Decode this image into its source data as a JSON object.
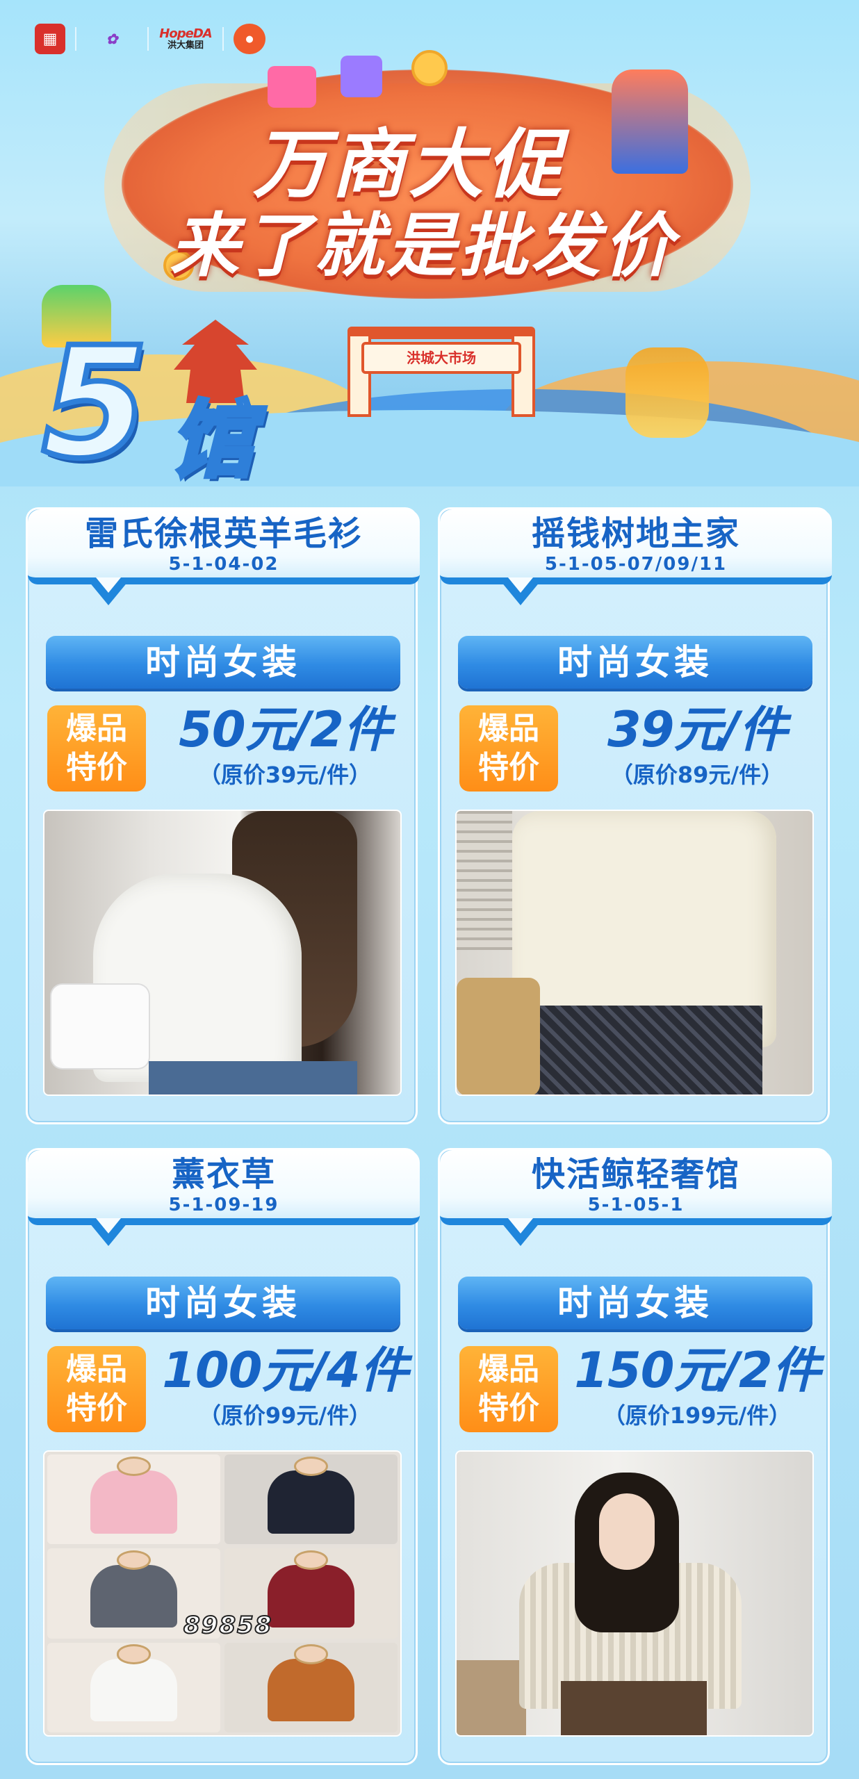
{
  "banner": {
    "logos": [
      "",
      "",
      "HopeDA",
      "洪大集团",
      ""
    ],
    "title_line1": "万商大促",
    "title_line2": "来了就是批发价",
    "gate_sign": "洪城大市场",
    "hall_number": "5",
    "hall_word": "馆"
  },
  "cards": [
    {
      "shop_name": "雷氏徐根英羊毛衫",
      "shop_code": "5-1-04-02",
      "category": "时尚女装",
      "badge_line1": "爆品",
      "badge_line2": "特价",
      "price": "50元/2件",
      "original_price": "（原价39元/件）"
    },
    {
      "shop_name": "摇钱树地主家",
      "shop_code": "5-1-05-07/09/11",
      "category": "时尚女装",
      "badge_line1": "爆品",
      "badge_line2": "特价",
      "price": "39元/件",
      "original_price": "（原价89元/件）"
    },
    {
      "shop_name": "薰衣草",
      "shop_code": "5-1-09-19",
      "category": "时尚女装",
      "badge_line1": "爆品",
      "badge_line2": "特价",
      "price": "100元/4件",
      "original_price": "（原价99元/件）",
      "photo_watermark": "89858"
    },
    {
      "shop_name": "快活鲸轻奢馆",
      "shop_code": "5-1-05-1",
      "category": "时尚女装",
      "badge_line1": "爆品",
      "badge_line2": "特价",
      "price": "150元/2件",
      "original_price": "（原价199元/件）"
    }
  ],
  "colors": {
    "accent_blue": "#1764c5",
    "badge_orange": "#ff8e17",
    "title_red": "#e55a2c"
  }
}
